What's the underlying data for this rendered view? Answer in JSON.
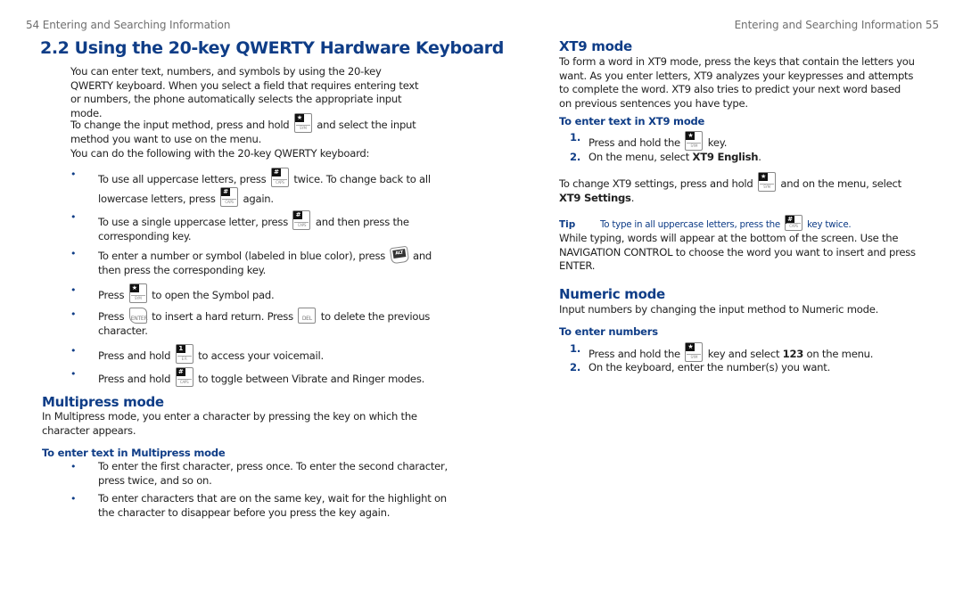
{
  "left_page": {
    "running_head": "54  Entering and Searching Information",
    "section_title": "2.2  Using the 20-key QWERTY Hardware Keyboard",
    "intro": "You can enter text, numbers, and symbols by using the 20-key QWERTY keyboard. When you select a field that requires entering text or numbers, the phone automatically selects the appropriate input mode.",
    "change_method": {
      "before": "To change the input method, press and hold ",
      "after": " and select the input method you want to use on the menu.",
      "key_icon": "sym-key-icon"
    },
    "list_intro": "You can do the following with the 20-key QWERTY keyboard:",
    "bullets": [
      {
        "parts": [
          "To use all uppercase letters, press ",
          " twice. To change back to all lowercase letters, press ",
          " again."
        ],
        "keys": [
          "caps-key-icon",
          "caps-key-icon"
        ]
      },
      {
        "parts": [
          "To use a single uppercase letter, press ",
          " and then press the corresponding key."
        ],
        "keys": [
          "caps-key-icon"
        ]
      },
      {
        "parts": [
          "To enter a number or symbol (labeled in blue color), press ",
          " and then press the corresponding key."
        ],
        "keys": [
          "alt-key-icon"
        ]
      },
      {
        "parts": [
          "Press ",
          " to open the Symbol pad."
        ],
        "keys": [
          "sym-key-icon"
        ]
      },
      {
        "parts": [
          "Press ",
          " to insert a hard return. Press ",
          " to delete the previous character."
        ],
        "keys": [
          "enter-key-icon",
          "delete-key-icon"
        ]
      },
      {
        "parts": [
          "Press and hold ",
          " to access your voicemail."
        ],
        "keys": [
          "voicemail-key-icon"
        ]
      },
      {
        "parts": [
          "Press and hold ",
          " to toggle between Vibrate and Ringer modes."
        ],
        "keys": [
          "caps-key-icon"
        ]
      }
    ],
    "multipress": {
      "heading": "Multipress mode",
      "body": "In Multipress mode, you enter a character by pressing the key on which the character appears.",
      "subheading": "To enter text in Multipress mode",
      "bullets": [
        "To enter the first character, press once. To enter the second character, press twice, and so on.",
        "To enter characters that are on the same key, wait for the highlight on the character to disappear before you press the key again."
      ]
    }
  },
  "right_page": {
    "running_head": "Entering and Searching Information  55",
    "xt9": {
      "heading": "XT9 mode",
      "body": "To form a word in XT9 mode, press the keys that contain the letters you want. As you enter letters, XT9 analyzes your keypresses and attempts to complete the word. XT9 also tries to predict your next word based on previous sentences you have type.",
      "subheading": "To enter text in XT9 mode",
      "steps": [
        {
          "num": "1.",
          "before": "Press and hold the ",
          "after": " key."
        },
        {
          "num": "2.",
          "before": "On the menu, select ",
          "bold": "XT9 English",
          "after": "."
        }
      ],
      "settings": {
        "before": "To change XT9 settings, press and hold ",
        "middle": " and on the menu, select ",
        "bold": "XT9 Settings",
        "after": "."
      },
      "tip_label": "Tip",
      "tip": {
        "before": "To type in all uppercase letters, press the ",
        "after": " key twice."
      },
      "typing_note": "While typing, words will appear at the bottom of the screen. Use the NAVIGATION CONTROL to choose the word you want to insert and press ENTER."
    },
    "numeric": {
      "heading": "Numeric mode",
      "body": "Input numbers by changing the input method to Numeric mode.",
      "subheading": "To enter numbers",
      "steps": [
        {
          "num": "1.",
          "before": "Press and hold the ",
          "middle": " key and select ",
          "bold": "123",
          "after": " on the menu."
        },
        {
          "num": "2.",
          "before": "On the keyboard, enter the number(s) you want."
        }
      ]
    }
  },
  "key_labels": {
    "sym_top": "★",
    "caps_top": "#",
    "alt_top": "ALT",
    "vm_top": "1",
    "sym_sub": "SYM",
    "caps_sub": "CAPS",
    "enter_sub": "ENTER",
    "del_sub": "DEL",
    "vm_sub": "E R"
  }
}
